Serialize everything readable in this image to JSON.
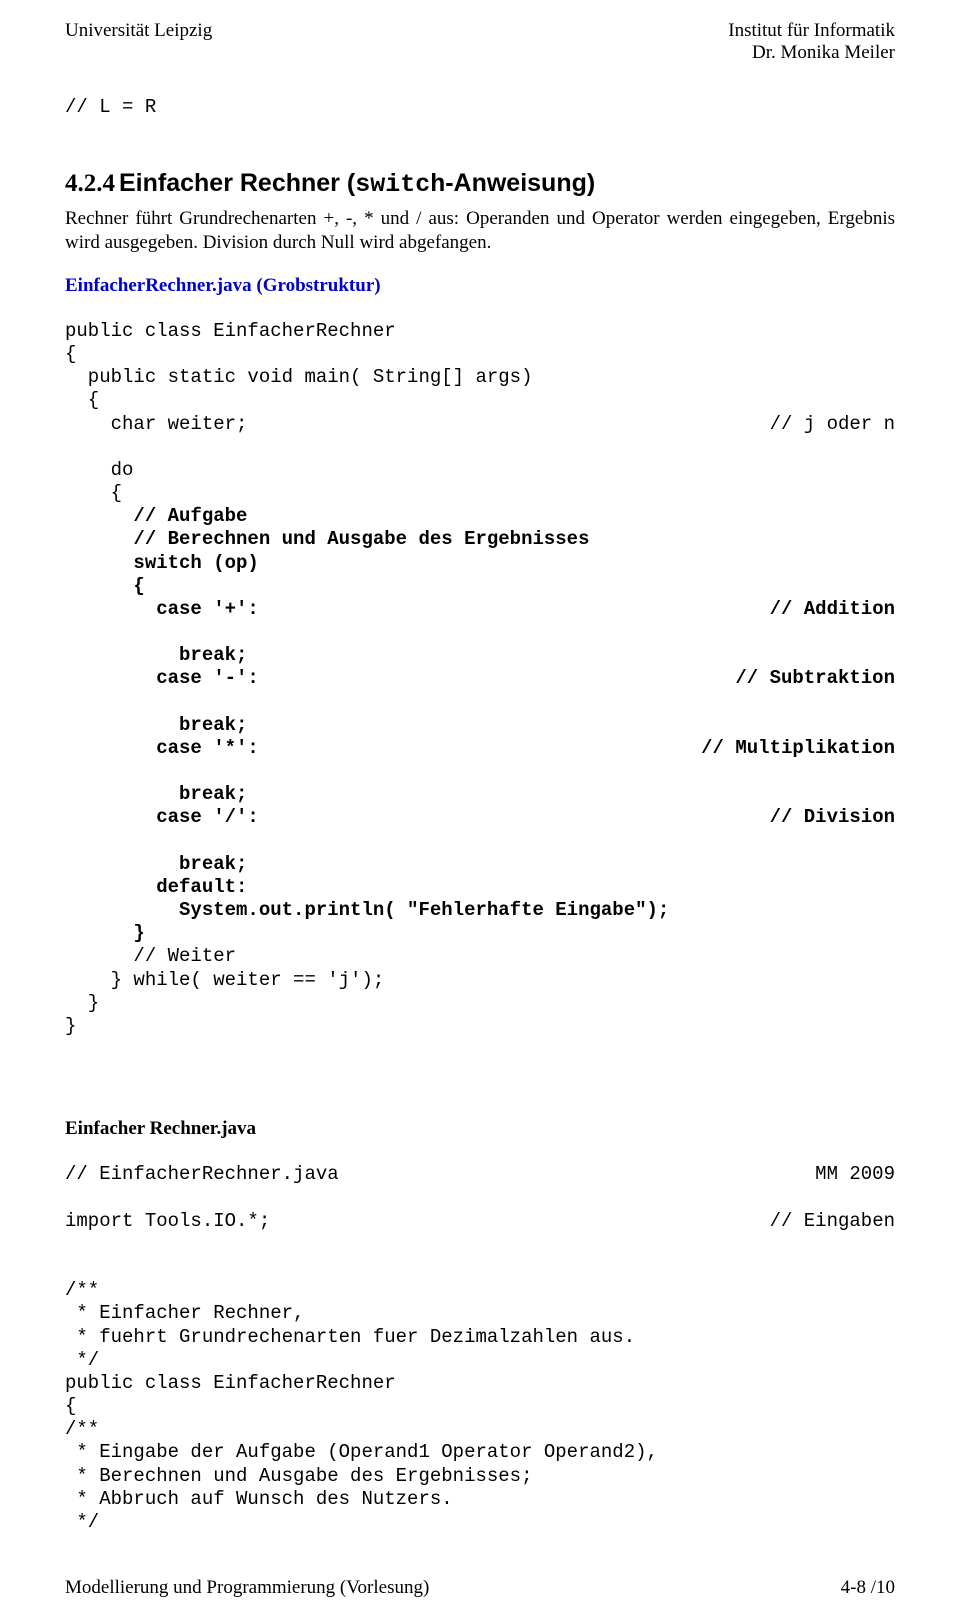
{
  "header": {
    "left": "Universität Leipzig",
    "right1": "Institut für Informatik",
    "right2": "Dr. Monika Meiler"
  },
  "line_lr": "// L = R",
  "section": {
    "num": "4.2.4",
    "title_plain": "Einfacher Rechner (",
    "title_mono": "switch",
    "title_rest": "-Anweisung)"
  },
  "intro": "Rechner führt Grundrechenarten +, -, * und / aus: Operanden und Operator werden eingegeben, Ergebnis wird ausgegeben. Division durch Null wird abgefangen.",
  "grob_head": "EinfacherRechner.java (Grobstruktur)",
  "code1": {
    "l01": "public class EinfacherRechner",
    "l02": "{",
    "l03": "  public static void main( String[] args)",
    "l04": "  {",
    "l05a": "    char weiter;",
    "l05b": "// j oder n",
    "l06": "    do",
    "l07": "    {",
    "l08": "      // Aufgabe",
    "l09": "      // Berechnen und Ausgabe des Ergebnisses",
    "l10": "      switch (op)",
    "l11": "      {",
    "l12a": "        case '+':",
    "l12b": "// Addition",
    "l13": "          break;",
    "l14a": "        case '-':",
    "l14b": "// Subtraktion",
    "l15": "          break;",
    "l16a": "        case '*':",
    "l16b": "// Multiplikation",
    "l17": "          break;",
    "l18a": "        case '/':",
    "l18b": "// Division",
    "l19": "          break;",
    "l20": "        default:",
    "l21": "          System.out.println( \"Fehlerhafte Eingabe\");",
    "l22": "      }",
    "l23": "      // Weiter",
    "l24": "    } while( weiter == 'j');",
    "l25": "  }",
    "l26": "}"
  },
  "java_head": "Einfacher Rechner.java",
  "code2": {
    "l01a": "// EinfacherRechner.java",
    "l01b": "MM 2009",
    "l02a": "import Tools.IO.*;",
    "l02b": "// Eingaben",
    "l03": "",
    "l04": "/**",
    "l05": " * Einfacher Rechner,",
    "l06": " * fuehrt Grundrechenarten fuer Dezimalzahlen aus.",
    "l07": " */",
    "l08": "public class EinfacherRechner",
    "l09": "{",
    "l10": "/**",
    "l11": " * Eingabe der Aufgabe (Operand1 Operator Operand2),",
    "l12": " * Berechnen und Ausgabe des Ergebnisses;",
    "l13": " * Abbruch auf Wunsch des Nutzers.",
    "l14": " */"
  },
  "footer": {
    "left": "Modellierung und Programmierung (Vorlesung)",
    "right": "4-8 /10"
  }
}
